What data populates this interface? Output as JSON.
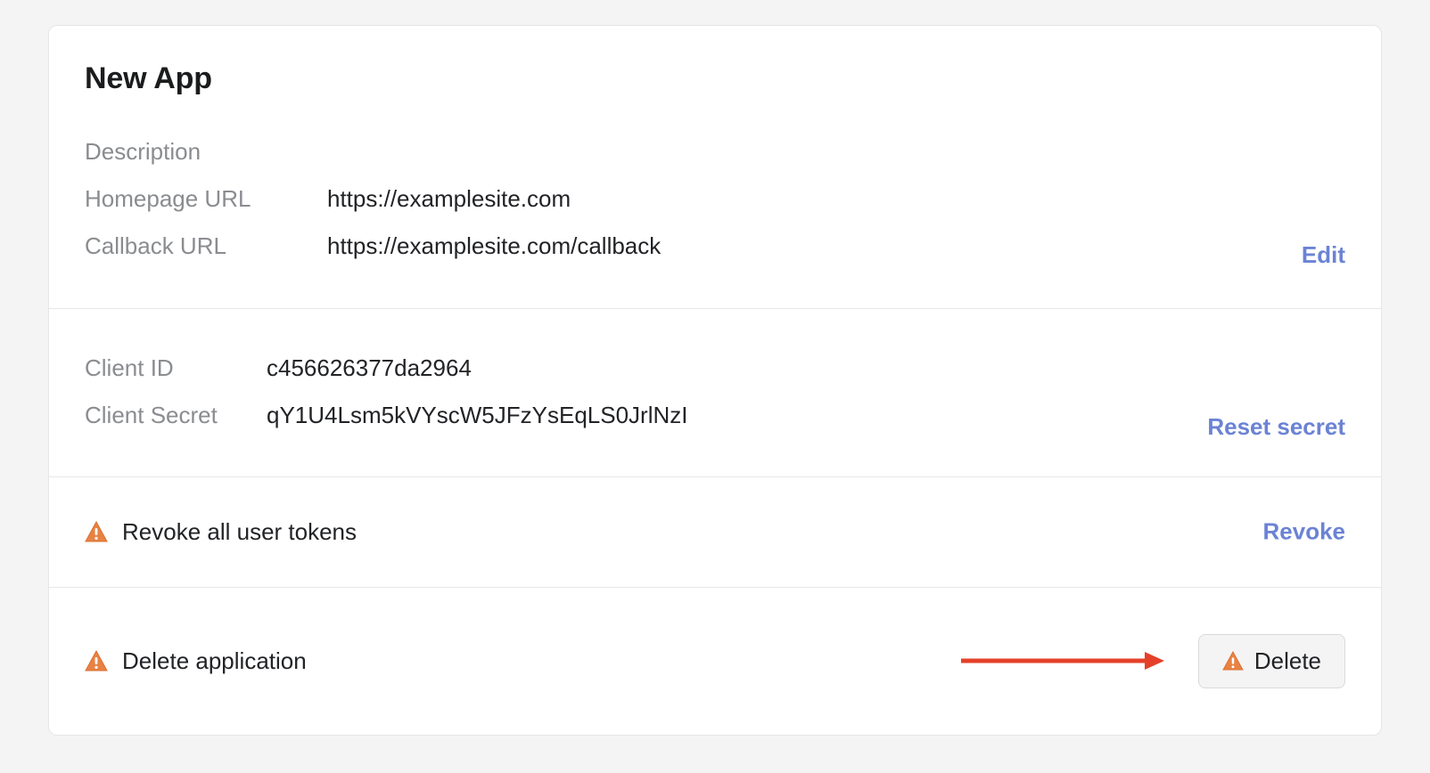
{
  "header": {
    "title": "New App"
  },
  "details": {
    "description_label": "Description",
    "homepage_label": "Homepage URL",
    "homepage_value": "https://examplesite.com",
    "callback_label": "Callback URL",
    "callback_value": "https://examplesite.com/callback",
    "edit_action": "Edit"
  },
  "credentials": {
    "client_id_label": "Client ID",
    "client_id_value": "c456626377da2964",
    "client_secret_label": "Client Secret",
    "client_secret_value": "qY1U4Lsm5kVYscW5JFzYsEqLS0JrlNzI",
    "reset_action": "Reset secret"
  },
  "revoke": {
    "label": "Revoke all user tokens",
    "action": "Revoke"
  },
  "delete": {
    "label": "Delete application",
    "button": "Delete"
  },
  "colors": {
    "link": "#6b83d4",
    "warning": "#e88243",
    "warning_stroke": "#da6f2f",
    "arrow": "#e5412a"
  }
}
